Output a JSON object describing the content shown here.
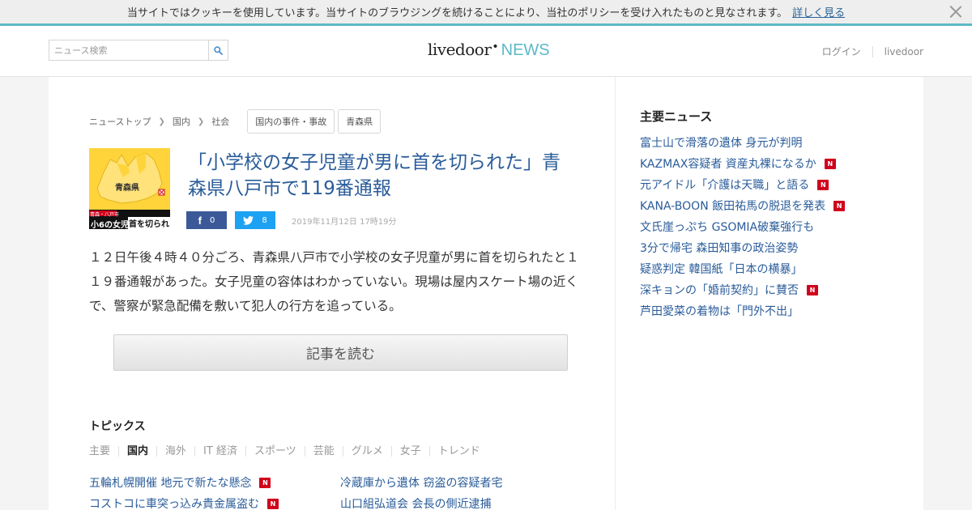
{
  "cookie": {
    "text": "当サイトではクッキーを使用しています。当サイトのブラウジングを続けることにより、当社のポリシーを受け入れたものと見なされます。",
    "link": "詳しく見る"
  },
  "header": {
    "search_placeholder": "ニュース検索",
    "logo_main": "livedoor",
    "logo_dot": "•",
    "logo_news": "NEWS",
    "login": "ログイン",
    "livedoor_link": "livedoor"
  },
  "breadcrumb": {
    "items": [
      "ニューストップ",
      "国内",
      "社会"
    ],
    "tags": [
      "国内の事件・事故",
      "青森県"
    ]
  },
  "thumbnail": {
    "region_label": "青森県",
    "caption_small": "青森・八戸市",
    "caption_left": "小6の女児",
    "caption_right": "首を切られ"
  },
  "article": {
    "title": "「小学校の女子児童が男に首を切られた」青森県八戸市で119番通報",
    "fb_count": "0",
    "tw_count": "8",
    "date": "2019年11月12日 17時19分",
    "lead": "１２日午後４時４０分ごろ、青森県八戸市で小学校の女子児童が男に首を切られたと１１９番通報があった。女子児童の容体はわかっていない。現場は屋内スケート場の近くで、警察が緊急配備を敷いて犯人の行方を追っている。",
    "read_button": "記事を読む"
  },
  "topics": {
    "title": "トピックス",
    "tabs": [
      "主要",
      "国内",
      "海外",
      "IT 経済",
      "スポーツ",
      "芸能",
      "グルメ",
      "女子",
      "トレンド"
    ],
    "active_tab": "国内",
    "left": [
      {
        "text": "五輪札幌開催 地元で新たな懸念",
        "badge": "N"
      },
      {
        "text": "コストコに車突っ込み貴金属盗む",
        "badge": "N"
      }
    ],
    "right": [
      {
        "text": "冷蔵庫から遺体 窃盗の容疑者宅",
        "badge": ""
      },
      {
        "text": "山口組弘道会 会長の側近逮捕",
        "badge": ""
      }
    ]
  },
  "sidebar": {
    "title": "主要ニュース",
    "items": [
      {
        "text": "富士山で滑落の遺体 身元が判明",
        "badge": ""
      },
      {
        "text": "KAZMAX容疑者 資産丸裸になるか",
        "badge": "N"
      },
      {
        "text": "元アイドル「介護は天職」と語る",
        "badge": "N"
      },
      {
        "text": "KANA-BOON 飯田祐馬の脱退を発表",
        "badge": "N"
      },
      {
        "text": "文氏崖っぷち GSOMIA破棄強行も",
        "badge": ""
      },
      {
        "text": "3分で帰宅 森田知事の政治姿勢",
        "badge": ""
      },
      {
        "text": "疑惑判定 韓国紙「日本の横暴」",
        "badge": ""
      },
      {
        "text": "深キョンの「婚前契約」に賛否",
        "badge": "N"
      },
      {
        "text": "芦田愛菜の着物は「門外不出」",
        "badge": ""
      }
    ]
  },
  "colors": {
    "accent": "#5cb9c8",
    "link": "#2a5c9a",
    "badge": "#d0021b",
    "facebook": "#3b5998",
    "twitter": "#1da1f2"
  }
}
